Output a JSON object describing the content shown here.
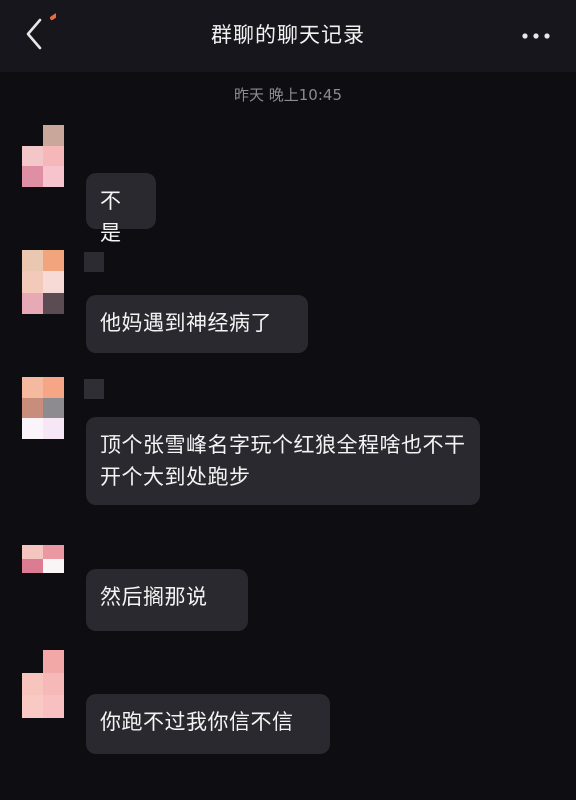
{
  "header": {
    "title": "群聊的聊天记录",
    "back_icon": "chevron-left-icon",
    "more_icon": "more-horizontal-icon"
  },
  "timestamp": "昨天 晚上10:45",
  "messages": [
    {
      "text": "不是"
    },
    {
      "text": "他妈遇到神经病了"
    },
    {
      "text": "顶个张雪峰名字玩个红狼全程啥也不干开个大到处跑步"
    },
    {
      "text": "然后搁那说"
    },
    {
      "text": "你跑不过我你信不信"
    }
  ],
  "colors": {
    "background": "#0e0d12",
    "header": "#17161c",
    "bubble": "#2a292f",
    "accent_stroke": "#f0693a"
  }
}
